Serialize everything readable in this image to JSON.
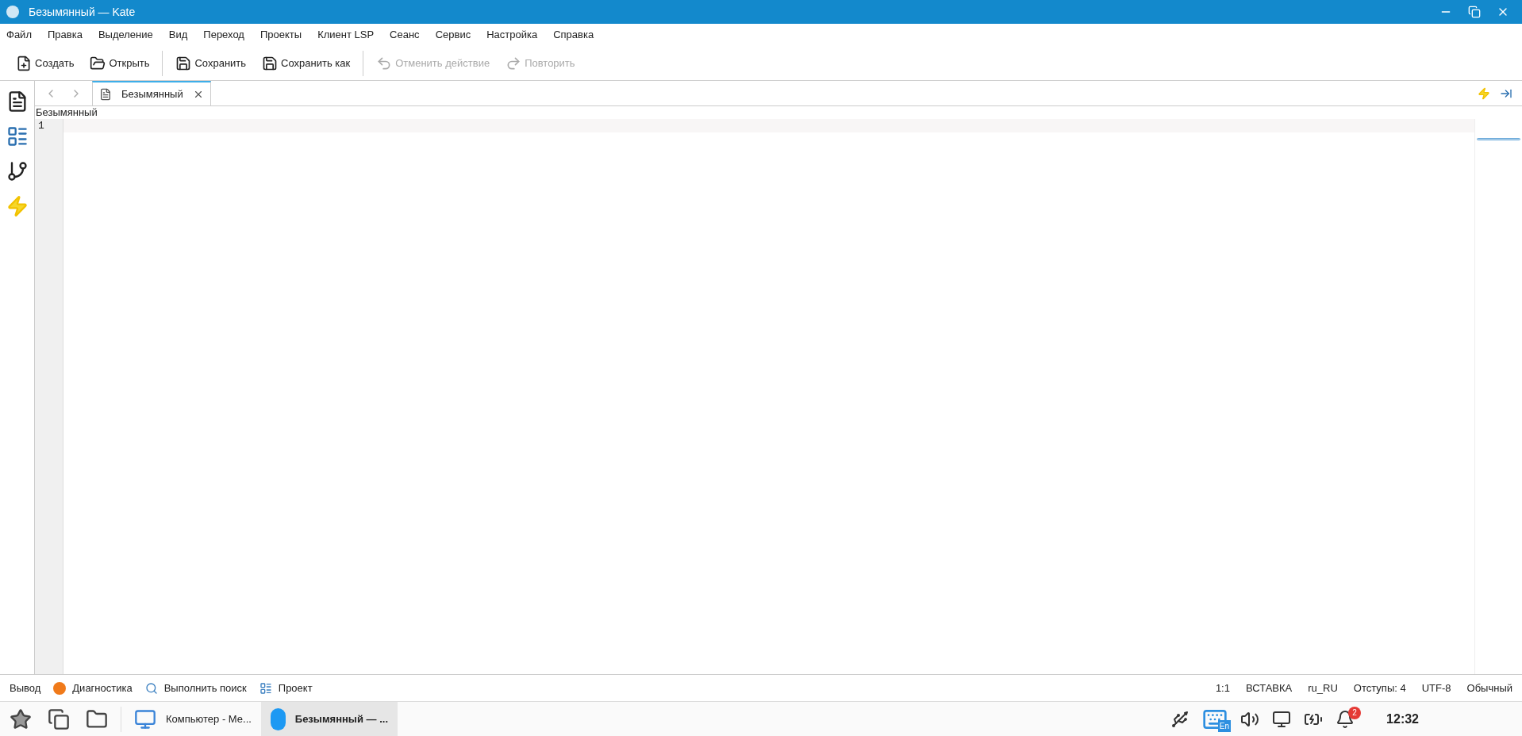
{
  "window": {
    "title": "Безымянный  — Kate"
  },
  "menu": [
    "Файл",
    "Правка",
    "Выделение",
    "Вид",
    "Переход",
    "Проекты",
    "Клиент LSP",
    "Сеанс",
    "Сервис",
    "Настройка",
    "Справка"
  ],
  "toolbar": [
    {
      "kind": "new",
      "label": "Создать",
      "disabled": false
    },
    {
      "kind": "open",
      "label": "Открыть",
      "disabled": false
    },
    {
      "kind": "save",
      "label": "Сохранить",
      "disabled": false
    },
    {
      "kind": "saveas",
      "label": "Сохранить как",
      "disabled": false
    },
    {
      "kind": "undo",
      "label": "Отменить действие",
      "disabled": true
    },
    {
      "kind": "redo",
      "label": "Повторить",
      "disabled": true
    }
  ],
  "sidebar": [
    {
      "kind": "documents"
    },
    {
      "kind": "filesystem"
    },
    {
      "kind": "git"
    },
    {
      "kind": "lightning"
    }
  ],
  "tabs": [
    {
      "label": "Безымянный",
      "selected": true
    }
  ],
  "breadcrumb": "Безымянный",
  "editor": {
    "line_numbers": [
      "1"
    ]
  },
  "bottom_tabs": [
    {
      "kind": "output",
      "label": "Вывод"
    },
    {
      "kind": "diagnostics",
      "label": "Диагностика"
    },
    {
      "kind": "search",
      "label": "Выполнить поиск"
    },
    {
      "kind": "project",
      "label": "Проект"
    }
  ],
  "status_bar": [
    "1:1",
    "ВСТАВКА",
    "ru_RU",
    "Отступы: 4",
    "UTF-8",
    "Обычный"
  ],
  "taskbar": {
    "tasks": [
      {
        "kind": "computer",
        "label": "Компьютер - Ме...",
        "selected": false
      },
      {
        "kind": "kate",
        "label": "Безымянный  — ...",
        "selected": true
      }
    ],
    "keyboard_layout": "En",
    "notifications": "2",
    "clock": "12:32"
  }
}
